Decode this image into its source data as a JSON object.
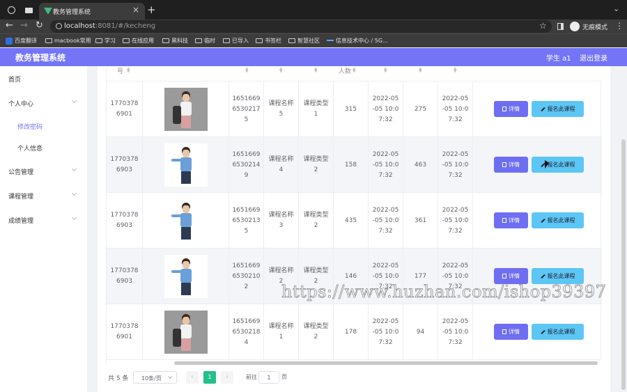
{
  "browser": {
    "tab_title": "教务管理系统",
    "url_host": "localhost",
    "url_rest": ":8081/#/kecheng",
    "incognito_label": "无痕模式",
    "bookmarks": [
      "百度翻译",
      "macbook常用",
      "学习",
      "在线应用",
      "黑科技",
      "临时",
      "已导入",
      "书签栏",
      "智慧社区",
      "信息技术中心 / 5G..."
    ]
  },
  "header": {
    "title": "教务管理系统",
    "user": "学生 a1",
    "logout": "退出登录"
  },
  "sidebar": {
    "items": [
      {
        "label": "首页"
      },
      {
        "label": "个人中心",
        "children": [
          {
            "label": "修改密码",
            "active": true
          },
          {
            "label": "个人信息"
          }
        ]
      },
      {
        "label": "公告管理"
      },
      {
        "label": "课程管理"
      },
      {
        "label": "成绩管理"
      }
    ]
  },
  "table": {
    "headers": [
      "号",
      "",
      "",
      "",
      "",
      "人数",
      "",
      "",
      ""
    ],
    "rows": [
      {
        "teacher_id": "1770378\n6901",
        "course_no": "1651669\n6530217\n5",
        "name": "课程名称\n5",
        "type": "课程类型\n1",
        "count": "315",
        "start": "2022-05\n-05 10:0\n7:32",
        "n2": "275",
        "end": "2022-05\n-05 10:0\n7:32",
        "photo": "pair"
      },
      {
        "teacher_id": "1770378\n6903",
        "course_no": "1651669\n6530214\n9",
        "name": "课程名称\n4",
        "type": "课程类型\n2",
        "count": "158",
        "start": "2022-05\n-05 10:0\n7:32",
        "n2": "463",
        "end": "2022-05\n-05 10:0\n7:32",
        "photo": "man"
      },
      {
        "teacher_id": "1770378\n6903",
        "course_no": "1651669\n6530213\n5",
        "name": "课程名称\n3",
        "type": "课程类型\n2",
        "count": "435",
        "start": "2022-05\n-05 10:0\n7:32",
        "n2": "361",
        "end": "2022-05\n-05 10:0\n7:32",
        "photo": "man"
      },
      {
        "teacher_id": "1770378\n6903",
        "course_no": "1651669\n6530210\n2",
        "name": "课程名称\n2",
        "type": "课程类型\n2",
        "count": "146",
        "start": "2022-05\n-05 10:0\n7:32",
        "n2": "177",
        "end": "2022-05\n-05 10:0\n7:32",
        "photo": "man"
      },
      {
        "teacher_id": "1770378\n6901",
        "course_no": "1651669\n6530218\n4",
        "name": "课程名称\n1",
        "type": "课程类型\n2",
        "count": "178",
        "start": "2022-05\n-05 10:0\n7:32",
        "n2": "94",
        "end": "2022-05\n-05 10:0\n7:32",
        "photo": "pair"
      }
    ],
    "detail_label": "详情",
    "enroll_label": "报名此课程"
  },
  "pagination": {
    "total": "共 5 条",
    "page_size": "10条/页",
    "prev": "‹",
    "current": "1",
    "next": "›",
    "goto_label": "前往",
    "goto_value": "1",
    "page_suffix": "页"
  },
  "watermark": "https://www.huzhan.com/ishop39397"
}
